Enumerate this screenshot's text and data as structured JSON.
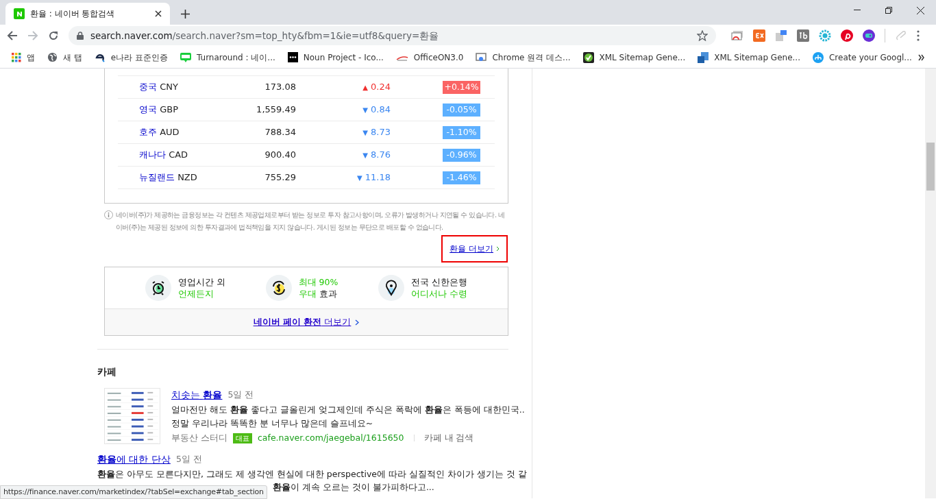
{
  "browser": {
    "tab_title": "환율 : 네이버 통합검색",
    "url_host": "search.naver.com",
    "url_path": "/search.naver?sm=top_hty&fbm=1&ie=utf8&query=환율",
    "bookmarks": [
      {
        "label": "앱",
        "kind": "apps"
      },
      {
        "label": "새 탭",
        "kind": "globe"
      },
      {
        "label": "e나라 표준인증",
        "kind": "e"
      },
      {
        "label": "Turnaround : 네이...",
        "kind": "blog"
      },
      {
        "label": "Noun Project - Ico...",
        "kind": "noun"
      },
      {
        "label": "OfficeON3.0",
        "kind": "office"
      },
      {
        "label": "Chrome 원격 데스...",
        "kind": "remote"
      },
      {
        "label": "XML Sitemap Gene...",
        "kind": "check"
      },
      {
        "label": "XML Sitemap Gene...",
        "kind": "sitemap"
      },
      {
        "label": "Create your Googl...",
        "kind": "tree"
      }
    ]
  },
  "rates": [
    {
      "country": "중국",
      "code": "CNY",
      "value": "173.08",
      "rising": true,
      "arrow": "▲",
      "change": "0.24",
      "percent": "+0.14%"
    },
    {
      "country": "영국",
      "code": "GBP",
      "value": "1,559.49",
      "rising": false,
      "arrow": "▼",
      "change": "0.84",
      "percent": "-0.05%"
    },
    {
      "country": "호주",
      "code": "AUD",
      "value": "788.34",
      "rising": false,
      "arrow": "▼",
      "change": "8.73",
      "percent": "-1.10%"
    },
    {
      "country": "캐나다",
      "code": "CAD",
      "value": "900.40",
      "rising": false,
      "arrow": "▼",
      "change": "8.76",
      "percent": "-0.96%"
    },
    {
      "country": "뉴질랜드",
      "code": "NZD",
      "value": "755.29",
      "rising": false,
      "arrow": "▼",
      "change": "11.18",
      "percent": "-1.46%"
    }
  ],
  "notice": "네이버(주)가 제공하는 금융정보는 각 컨텐츠 제공업체로부터 받는 정보로 투자 참고사항이며, 오류가 발생하거나 지연될 수 있습니다. 네이버(주)는 제공된 정보에 의한 투자결과에 법적책임을 지지 않습니다. 게시된 정보는 무단으로 배포할 수 없습니다.",
  "more_link": {
    "label": "환율 더보기",
    "highlighted": true
  },
  "pay": {
    "features": [
      {
        "kind": "clock",
        "lines": [
          [
            {
              "text": "영업시간 외",
              "green": false
            }
          ],
          [
            {
              "text": "언제든지",
              "green": true
            }
          ]
        ]
      },
      {
        "kind": "coin",
        "lines": [
          [
            {
              "text": "최대 90%",
              "green": true
            }
          ],
          [
            {
              "text": "우대",
              "green": true
            },
            {
              "text": " 효과",
              "green": false
            }
          ]
        ]
      },
      {
        "kind": "pin",
        "lines": [
          [
            {
              "text": "전국 신한은행",
              "green": false
            }
          ],
          [
            {
              "text": "어디서나 수령",
              "green": true
            }
          ]
        ]
      }
    ],
    "link": "**네이버 페이 환전** 더보기"
  },
  "cafe": {
    "heading": "카페",
    "results": [
      {
        "picture": {
          "kind": "picture"
        },
        "title": "치솟는 **환율**",
        "date": "5일 전",
        "snippet": [
          "얼마전만 해도 **환율** 좋다고 글올린게 엊그제인데 주식은 폭락에 **환율**은 폭등에 대한민국..",
          "정말 우리나라 똑똑한 분 너무나 많은데 슬프네요~"
        ],
        "source": "부동산 스터디",
        "badge": "대표",
        "cafe_url": "cafe.naver.com/jaegebal/1615650",
        "search_in": "카페 내 검색"
      },
      {
        "title": "**환율**에 대한 단상",
        "date": "5일 전",
        "snippet": [
          "**환율**은 아무도 모른다지만, 그래도 제 생각엔 현실에 대한 perspective에 따라 실질적인 차이가 생기는 것 같",
          "**환율**이 계속 오르는 것이 불가피하다고..."
        ]
      }
    ]
  },
  "status_url": "https://finance.naver.com/marketindex/?tabSel=exchange#tab_section"
}
